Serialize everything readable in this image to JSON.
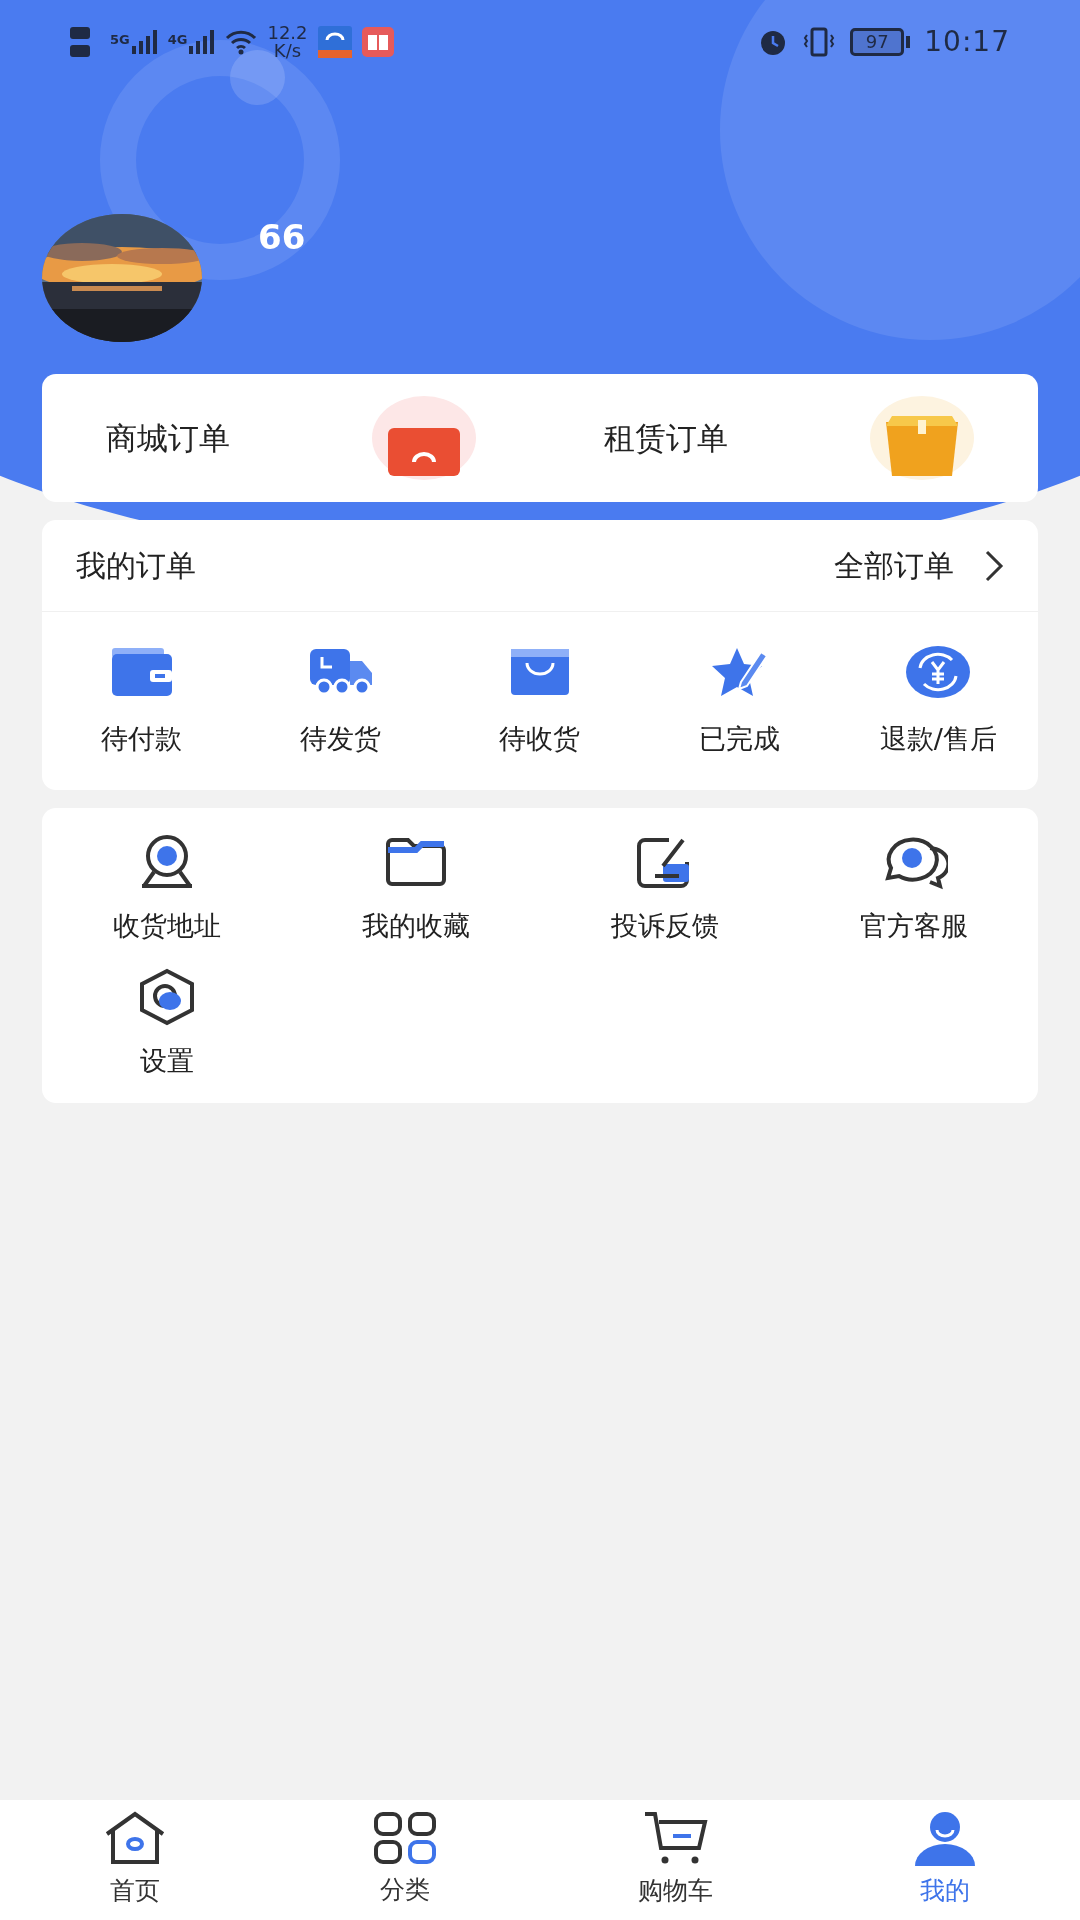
{
  "status_bar": {
    "network_labels": [
      "5G",
      "4G"
    ],
    "speed_value": "12.2",
    "speed_unit": "K/s",
    "battery": "97",
    "time": "10:17"
  },
  "profile": {
    "name": "66"
  },
  "order_shortcuts": [
    {
      "label": "商城订单",
      "kind": "mall"
    },
    {
      "label": "租赁订单",
      "kind": "rental"
    }
  ],
  "my_orders": {
    "title": "我的订单",
    "all_link": "全部订单",
    "items": [
      {
        "label": "待付款",
        "kind": "wallet"
      },
      {
        "label": "待发货",
        "kind": "truck"
      },
      {
        "label": "待收货",
        "kind": "bag"
      },
      {
        "label": "已完成",
        "kind": "star"
      },
      {
        "label": "退款/售后",
        "kind": "refund"
      }
    ]
  },
  "services": [
    {
      "label": "收货地址",
      "kind": "location"
    },
    {
      "label": "我的收藏",
      "kind": "folder"
    },
    {
      "label": "投诉反馈",
      "kind": "edit"
    },
    {
      "label": "官方客服",
      "kind": "chat"
    },
    {
      "label": "设置",
      "kind": "settings"
    }
  ],
  "tab_bar": [
    {
      "label": "首页",
      "kind": "home",
      "selected": false
    },
    {
      "label": "分类",
      "kind": "grid",
      "selected": false
    },
    {
      "label": "购物车",
      "kind": "cart",
      "selected": false
    },
    {
      "label": "我的",
      "kind": "user",
      "selected": true
    }
  ]
}
